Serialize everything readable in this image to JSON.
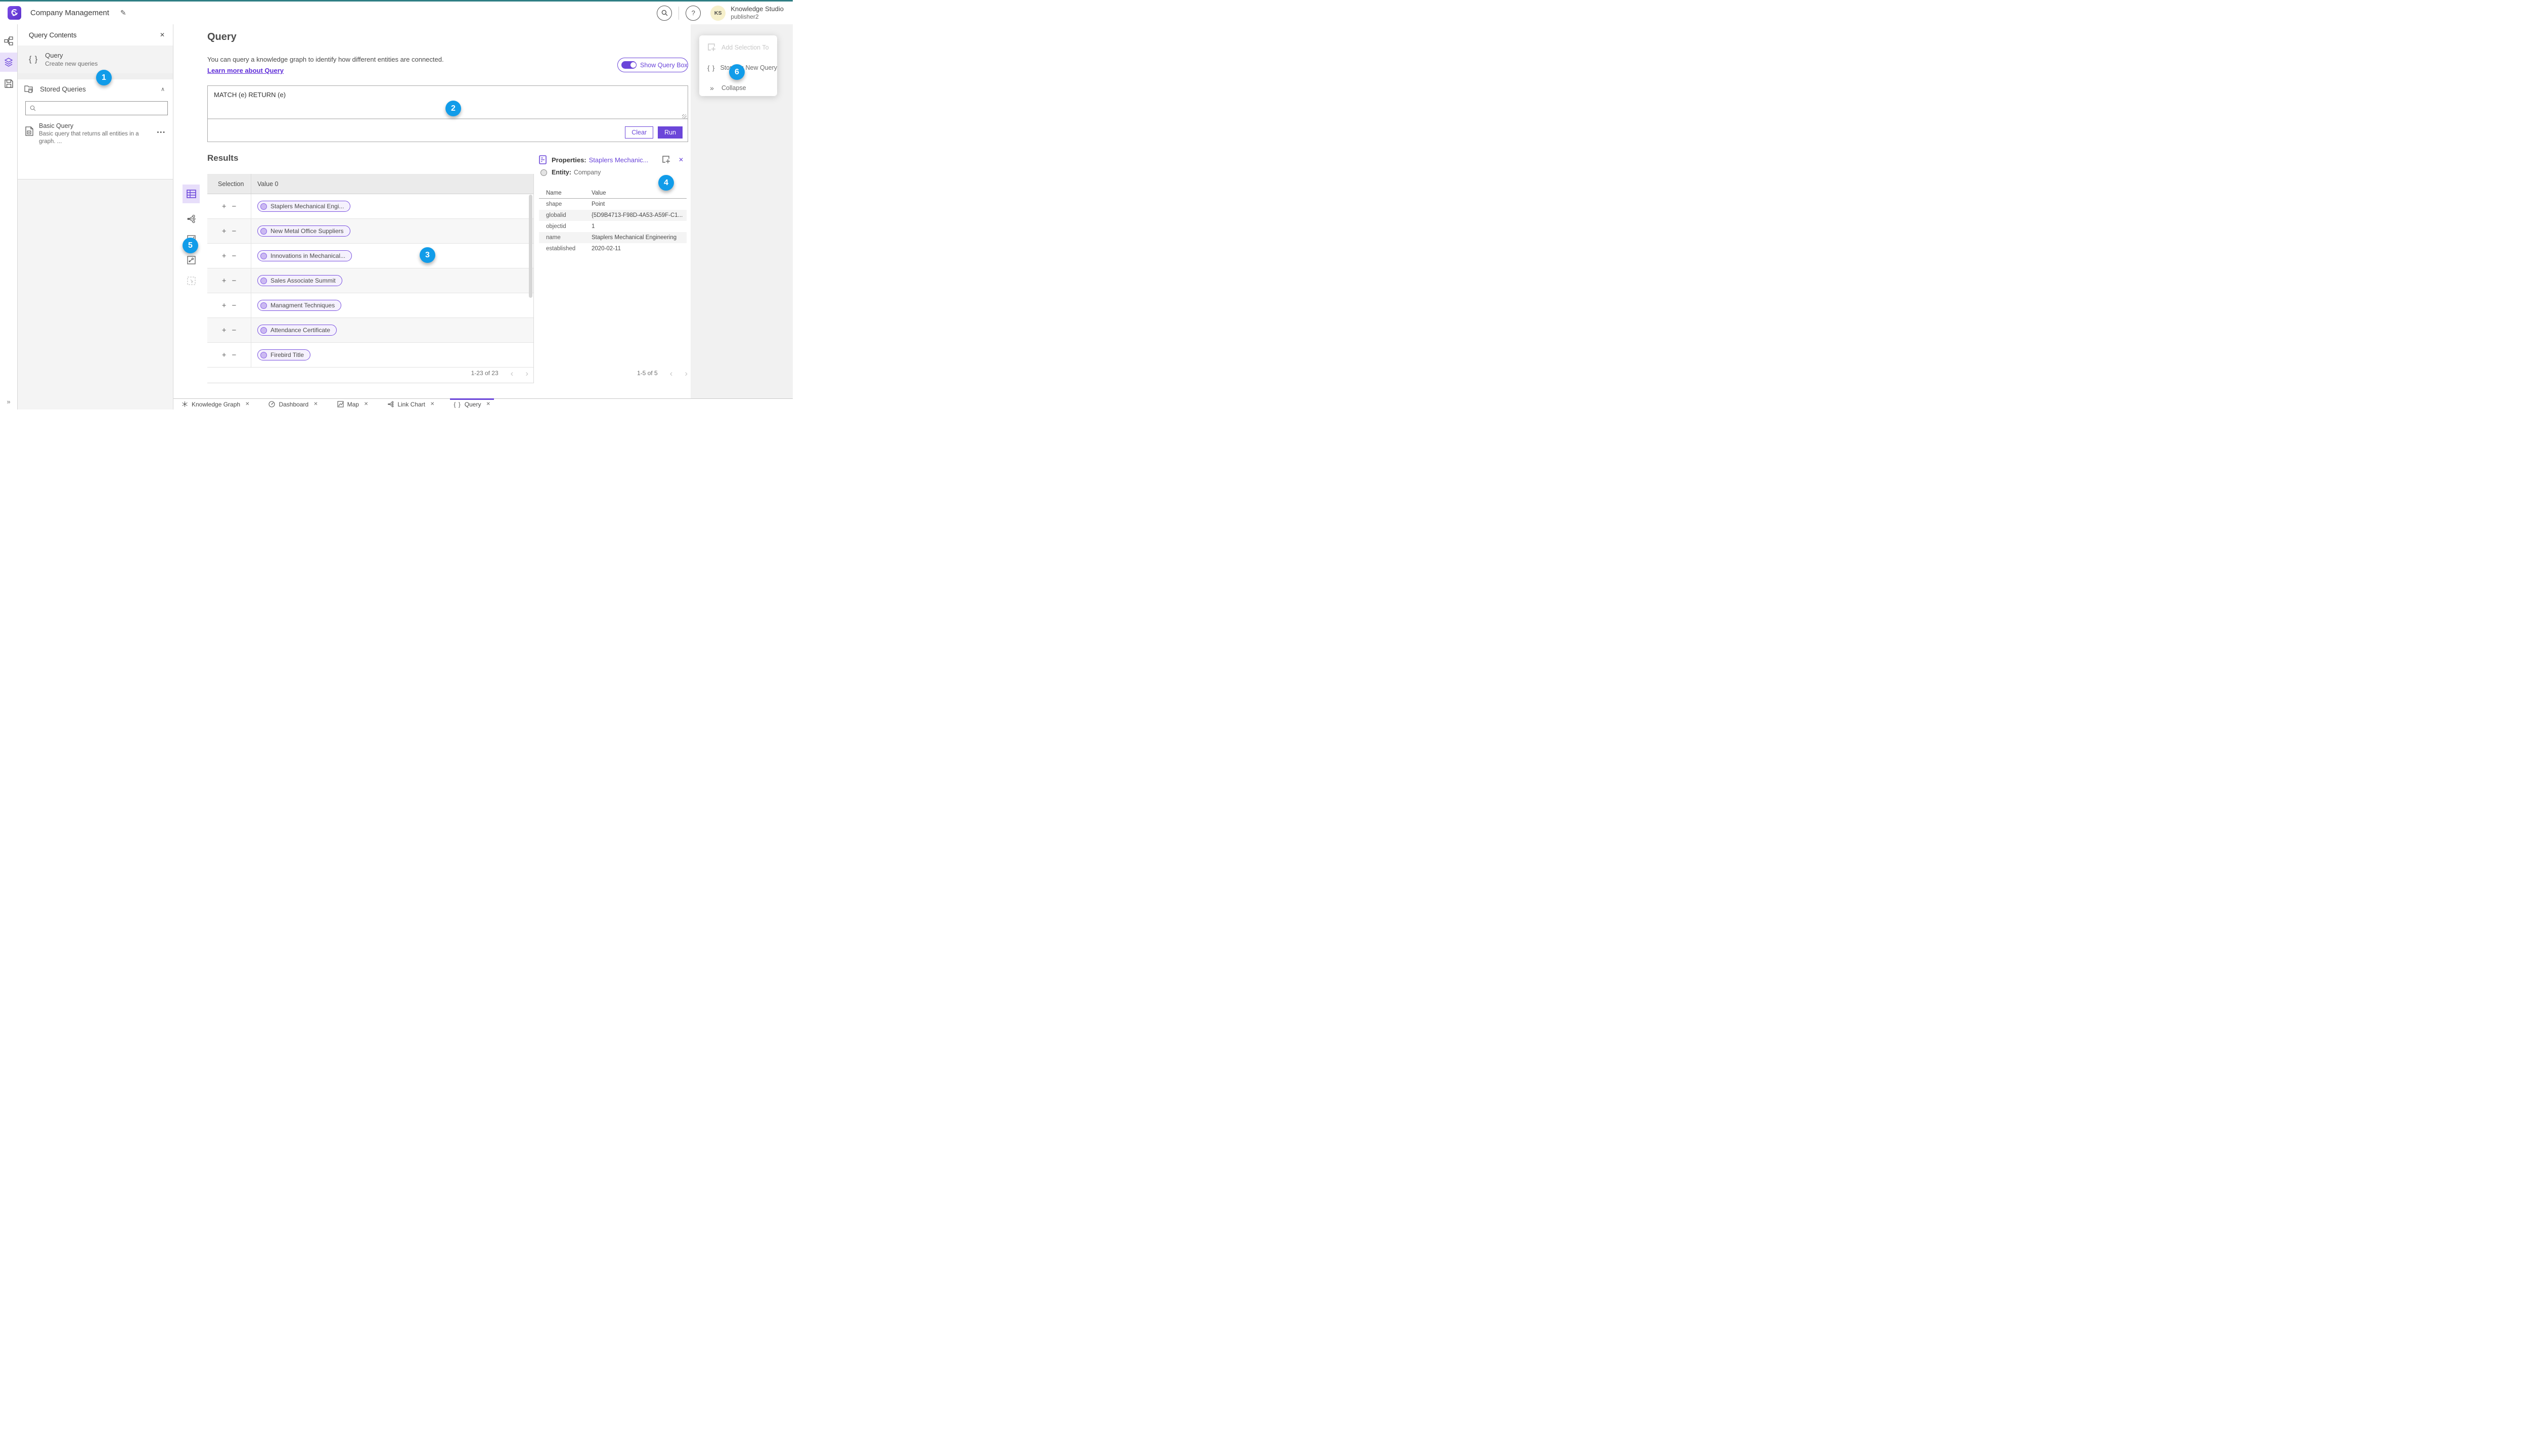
{
  "colors": {
    "accent": "#6B46D9",
    "badge_blue": "#119CE9",
    "teal_strip": "#2F7E84",
    "link_purple": "#5F2DD9"
  },
  "icons": {
    "pencil": "✎",
    "help": "?",
    "close": "✕",
    "caret_up": "∧",
    "ellipsis": "•••",
    "braces": "{ }",
    "chevrons_right": "»",
    "prev": "‹",
    "next": "›"
  },
  "header": {
    "app_title": "Company Management",
    "avatar": "KS",
    "user_name": "Knowledge Studio",
    "user_role": "publisher2"
  },
  "contents_panel": {
    "title": "Query Contents",
    "query_item": {
      "title": "Query",
      "subtitle": "Create new queries"
    },
    "stored_header": "Stored Queries",
    "search_placeholder": "",
    "stored_query": {
      "title": "Basic Query",
      "desc_line1": "Basic query that returns all entities in a",
      "desc_line2": "graph. ..."
    }
  },
  "query_page": {
    "title": "Query",
    "description": "You can query a knowledge graph to identify how different entities are connected.",
    "learn_link": "Learn more about Query",
    "toggle_label": "Show Query Box",
    "query_text": "MATCH (e) RETURN (e)",
    "clear_label": "Clear",
    "run_label": "Run"
  },
  "results": {
    "title": "Results",
    "col_selection": "Selection",
    "col_value": "Value 0",
    "plus": "+",
    "minus": "−",
    "rows": [
      "Staplers Mechanical Engi...",
      "New Metal Office Suppliers",
      "Innovations in Mechanical...",
      "Sales Associate Summit",
      "Managment Techniques",
      "Attendance Certificate",
      "Firebird Title"
    ],
    "pagination": "1-23 of 23"
  },
  "properties": {
    "label": "Properties:",
    "entity_link": "Staplers Mechanic...",
    "entity_label": "Entity:",
    "entity_value": "Company",
    "col_name": "Name",
    "col_value": "Value",
    "rows": [
      [
        "shape",
        "Point"
      ],
      [
        "globalid",
        "{5D9B4713-F98D-4A53-A59F-C1..."
      ],
      [
        "objectid",
        "1"
      ],
      [
        "name",
        "Staplers Mechanical Engineering"
      ],
      [
        "established",
        "2020-02-11"
      ]
    ],
    "pagination": "1-5 of 5"
  },
  "menu": {
    "items": [
      {
        "label": "Add Selection To"
      },
      {
        "label": "Store as New Query"
      },
      {
        "label": "Collapse"
      }
    ]
  },
  "tabs": [
    {
      "label": "Knowledge Graph"
    },
    {
      "label": "Dashboard"
    },
    {
      "label": "Map"
    },
    {
      "label": "Link Chart"
    },
    {
      "label": "Query"
    }
  ],
  "badges": [
    "1",
    "2",
    "3",
    "4",
    "5",
    "6"
  ]
}
